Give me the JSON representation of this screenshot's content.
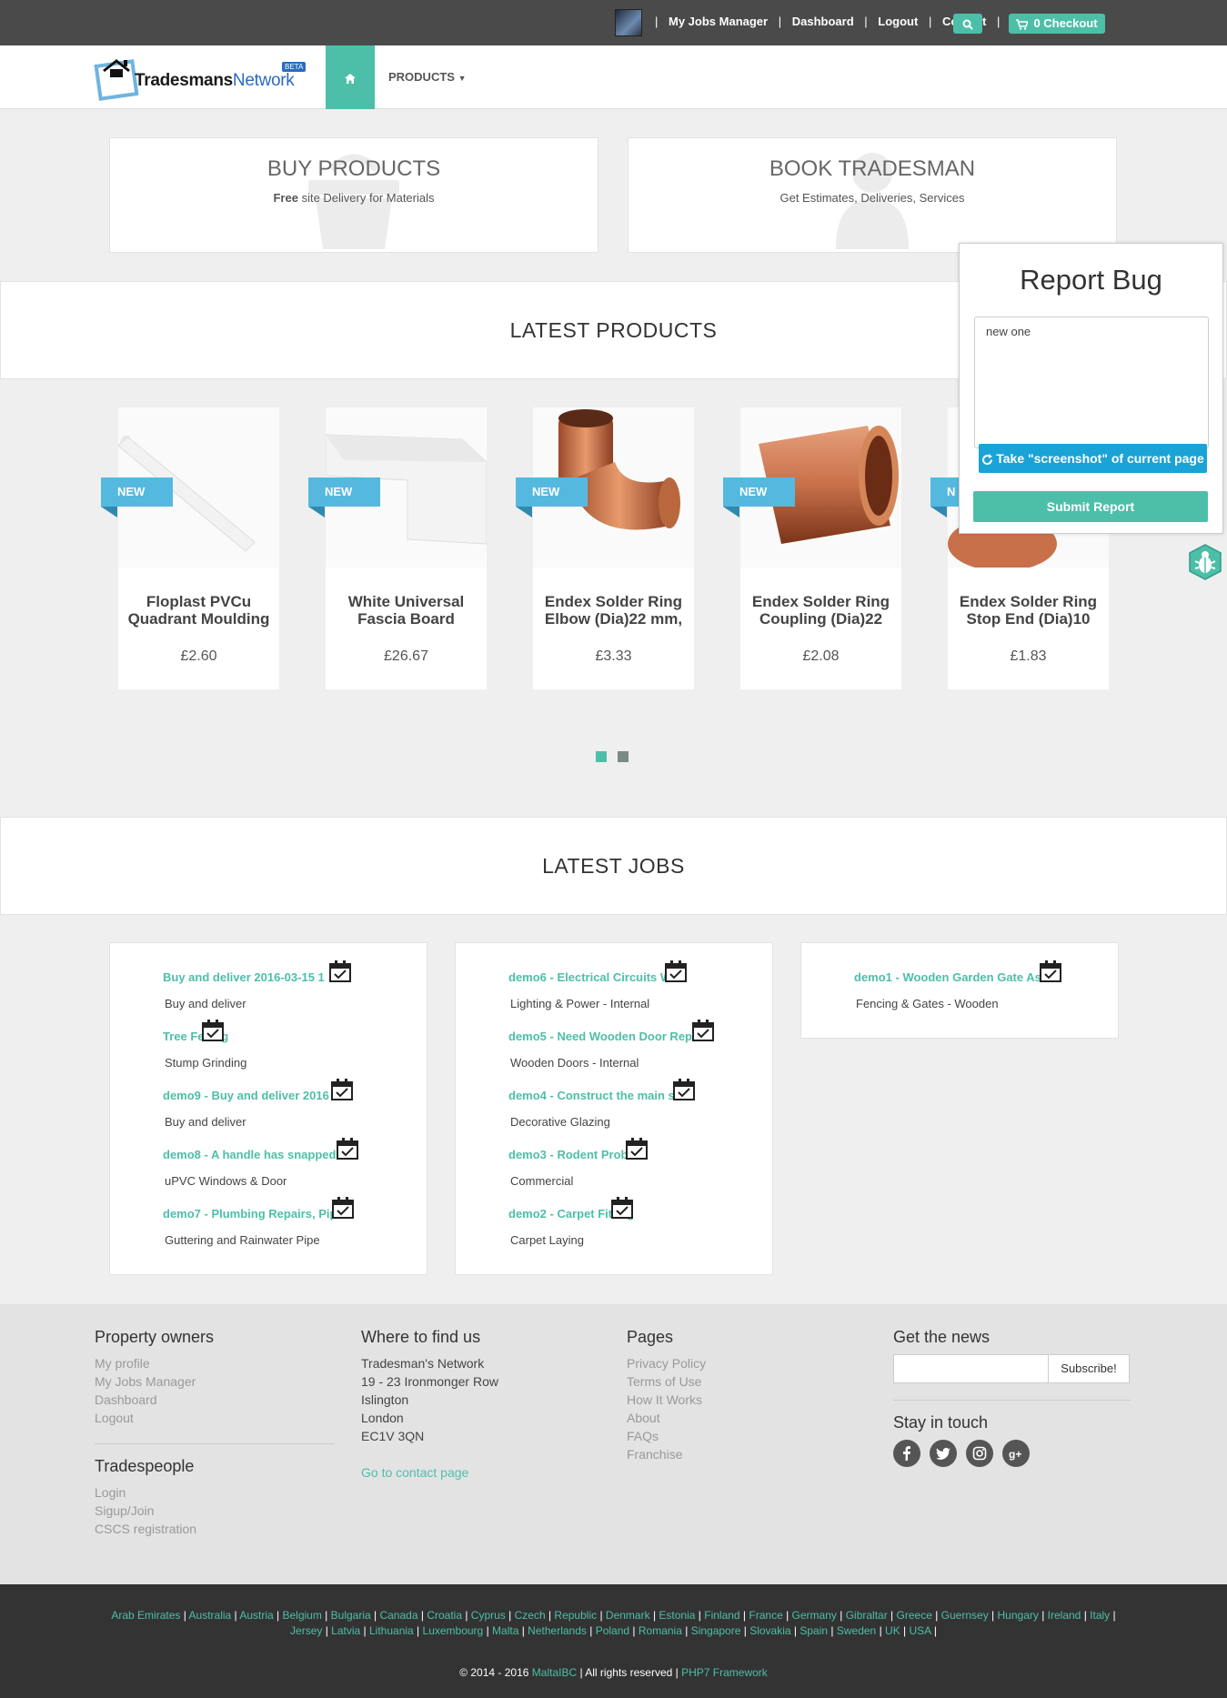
{
  "topbar": {
    "links": [
      "My Jobs Manager",
      "Dashboard",
      "Logout",
      "Contact"
    ],
    "checkout_label": "0 Checkout"
  },
  "header": {
    "logo_text_main": "radesmans",
    "logo_text_network": "Network",
    "logo_beta": "BETA",
    "products_menu": "PRODUCTS"
  },
  "services": [
    {
      "title": "BUY PRODUCTS",
      "desc_bold": "Free",
      "desc": " site Delivery for Materials"
    },
    {
      "title": "BOOK TRADESMAN",
      "desc_bold": "",
      "desc": "Get Estimates, Deliveries, Services"
    }
  ],
  "latest_products": {
    "heading": "LATEST PRODUCTS",
    "badge": "NEW",
    "items": [
      {
        "name": "Floplast PVCu Quadrant Moulding",
        "price": "£2.60"
      },
      {
        "name": "White Universal Fascia Board",
        "price": "£26.67"
      },
      {
        "name": "Endex Solder Ring Elbow (Dia)22 mm,",
        "price": "£3.33"
      },
      {
        "name": "Endex Solder Ring Coupling (Dia)22",
        "price": "£2.08"
      },
      {
        "name": "Endex Solder Ring Stop End (Dia)10",
        "price": "£1.83"
      }
    ]
  },
  "latest_jobs": {
    "heading": "LATEST JOBS",
    "columns": [
      [
        {
          "title": "Buy and deliver 2016-03-15 1",
          "category": "Buy and deliver"
        },
        {
          "title": "Tree Felling",
          "category": "Stump Grinding"
        },
        {
          "title": "demo9 - Buy and deliver 2016",
          "category": "Buy and deliver"
        },
        {
          "title": "demo8 - A handle has snapped",
          "category": "uPVC Windows & Door"
        },
        {
          "title": "demo7 - Plumbing Repairs, Pipe",
          "category": "Guttering and Rainwater Pipe"
        }
      ],
      [
        {
          "title": "demo6 - Electrical Circuits W",
          "category": "Lighting & Power - Internal"
        },
        {
          "title": "demo5 - Need Wooden Door Repair",
          "category": "Wooden Doors - Internal"
        },
        {
          "title": "demo4 - Construct the main st",
          "category": "Decorative Glazing"
        },
        {
          "title": "demo3 - Rodent Problem",
          "category": "Commercial"
        },
        {
          "title": "demo2 - Carpet Fitting",
          "category": "Carpet Laying"
        }
      ],
      [
        {
          "title": "demo1 - Wooden Garden Gate Ass",
          "category": "Fencing & Gates - Wooden"
        }
      ]
    ]
  },
  "report_bug": {
    "title": "Report Bug",
    "textarea_value": "new one",
    "screenshot_label": "Take \"screenshot\" of current page",
    "submit_label": "Submit Report"
  },
  "footer": {
    "property_owners": {
      "heading": "Property owners",
      "links": [
        "My profile",
        "My Jobs Manager",
        "Dashboard",
        "Logout"
      ]
    },
    "tradespeople": {
      "heading": "Tradespeople",
      "links": [
        "Login",
        "Sigup/Join",
        "CSCS registration"
      ]
    },
    "where": {
      "heading": "Where to find us",
      "lines": [
        "Tradesman's Network",
        "19 - 23 Ironmonger Row",
        "Islington",
        "London",
        "EC1V 3QN"
      ],
      "contact_link": "Go to contact page"
    },
    "pages": {
      "heading": "Pages",
      "links": [
        "Privacy Policy",
        "Terms of Use",
        "How It Works",
        "About",
        "FAQs",
        "Franchise"
      ]
    },
    "news": {
      "heading": "Get the news",
      "button": "Subscribe!"
    },
    "stay": {
      "heading": "Stay in touch"
    }
  },
  "countries": [
    "Arab Emirates",
    "Australia",
    "Austria",
    "Belgium",
    "Bulgaria",
    "Canada",
    "Croatia",
    "Cyprus",
    "Czech",
    "Republic",
    "Denmark",
    "Estonia",
    "Finland",
    "France",
    "Germany",
    "Gibraltar",
    "Greece",
    "Guernsey",
    "Hungary",
    "Ireland",
    "Italy",
    "Jersey",
    "Latvia",
    "Lithuania",
    "Luxembourg",
    "Malta",
    "Netherlands",
    "Poland",
    "Romania",
    "Singapore",
    "Slovakia",
    "Spain",
    "Sweden",
    "UK",
    "USA"
  ],
  "copyright": {
    "text": "© 2014 - 2016 ",
    "brand": "MaltaIBC",
    "mid": " | All rights reserved | ",
    "framework": "PHP7 Framework"
  },
  "colors": {
    "accent": "#4dbfa8",
    "badge": "#55b9df",
    "topbar": "#4a4a4a"
  }
}
